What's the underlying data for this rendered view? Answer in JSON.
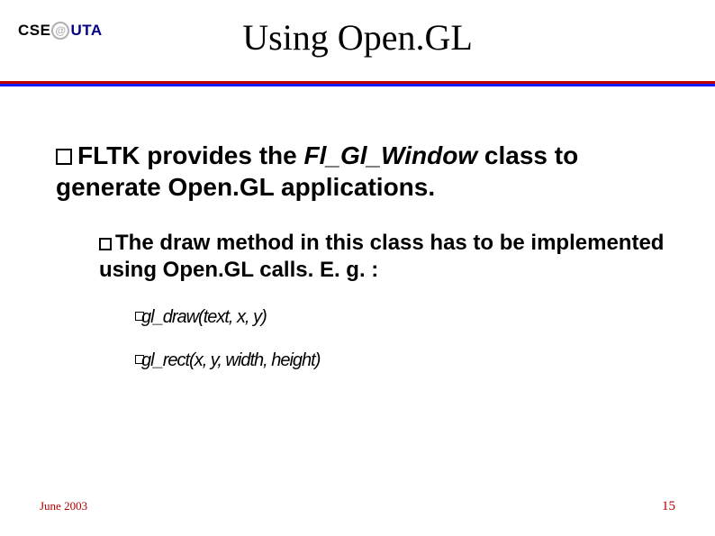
{
  "logo": {
    "left": "CSE",
    "right": "UTA"
  },
  "title": "Using Open.GL",
  "bullets": {
    "level1": {
      "pre": "FLTK provides the ",
      "italic": "Fl_Gl_Window",
      "post": " class to generate Open.GL applications."
    },
    "level2": "The draw method in this class has to be implemented using Open.GL calls. E. g. :",
    "level3a": "gl_draw(text, x, y)",
    "level3b": "gl_rect(x, y, width, height)"
  },
  "footer": {
    "date": "June 2003",
    "page": "15"
  }
}
